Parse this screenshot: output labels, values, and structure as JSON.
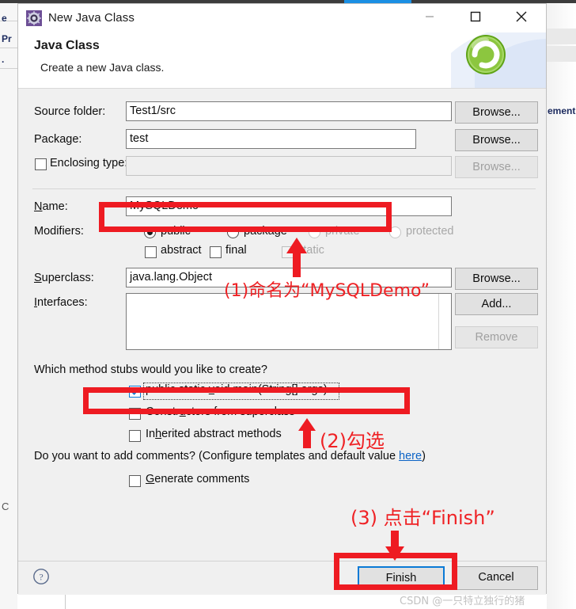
{
  "window": {
    "title": "New Java Class",
    "icon": "java-class-wizard-icon",
    "controls": {
      "minimize": "minimize-icon",
      "maximize": "maximize-icon",
      "close": "close-icon"
    }
  },
  "header": {
    "title": "Java Class",
    "subtitle": "Create a new Java class.",
    "banner_icon": "green-c-class-icon"
  },
  "form": {
    "source_folder": {
      "label": "Source folder:",
      "value": "Test1/src",
      "button": "Browse..."
    },
    "package": {
      "label": "Package:",
      "value": "test",
      "button": "Browse..."
    },
    "enclosing_type": {
      "label": "Enclosing type:",
      "value": "",
      "checked": false,
      "button": "Browse...",
      "button_disabled": true
    },
    "name": {
      "label": "Name:",
      "value": "MySQLDemo"
    },
    "modifiers": {
      "label": "Modifiers:",
      "radios": [
        {
          "label": "public",
          "selected": true,
          "disabled": false
        },
        {
          "label": "package",
          "selected": false,
          "disabled": false
        },
        {
          "label": "private",
          "selected": false,
          "disabled": true
        },
        {
          "label": "protected",
          "selected": false,
          "disabled": true
        }
      ],
      "checks": [
        {
          "label": "abstract",
          "checked": false,
          "disabled": false
        },
        {
          "label": "final",
          "checked": false,
          "disabled": false
        },
        {
          "label": "static",
          "checked": false,
          "disabled": true
        }
      ]
    },
    "superclass": {
      "label": "Superclass:",
      "value": "java.lang.Object",
      "button": "Browse..."
    },
    "interfaces": {
      "label": "Interfaces:",
      "items": [],
      "add_button": "Add...",
      "remove_button": "Remove",
      "remove_disabled": true
    },
    "stubs": {
      "question": "Which method stubs would you like to create?",
      "options": [
        {
          "label": "public static void main(String[] args)",
          "checked": true,
          "focused": true
        },
        {
          "label": "Constructors from superclass",
          "checked": false,
          "focused": false
        },
        {
          "label": "Inherited abstract methods",
          "checked": false,
          "focused": false
        }
      ]
    },
    "comments": {
      "question_prefix": "Do you want to add comments? (Configure templates and default value ",
      "link": "here",
      "question_suffix": ")",
      "checkbox": {
        "label": "Generate comments",
        "checked": false
      }
    }
  },
  "footer": {
    "help_icon": "help-question-icon",
    "finish_button": "Finish",
    "cancel_button": "Cancel"
  },
  "annotations": [
    {
      "id": "step-1",
      "text": "(1)命名为“MySQLDemo”"
    },
    {
      "id": "step-2",
      "text": "(2)勾选"
    },
    {
      "id": "step-3",
      "text": "(3)  点击“Finish”"
    }
  ],
  "background": {
    "left_labels": [
      "e",
      "Pr",
      "."
    ],
    "right_label": "ement",
    "accent_color": "#1a8fe3"
  },
  "watermark": "CSDN @一只特立独行的猪",
  "colors": {
    "annotation_red": "#ee1b22",
    "focus_blue": "#0a7ad6",
    "dialog_bg": "#f0f0f0"
  }
}
